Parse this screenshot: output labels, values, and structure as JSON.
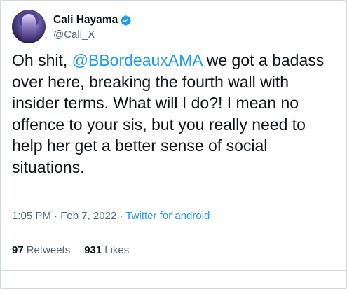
{
  "author": {
    "display_name": "Cali Hayama",
    "handle": "@Cali_X",
    "verified": true,
    "avatar_icon": "avatar-image"
  },
  "tweet": {
    "text_before": "Oh shit, ",
    "mention": "@BBordeauxAMA",
    "text_after": " we got a badass over here, breaking the fourth wall with insider terms. What will I do?! I mean no offence to your sis, but you really need to help her get a better sense of social situations."
  },
  "meta": {
    "time": "1:05 PM",
    "date": "Feb 7, 2022",
    "separator": " · ",
    "source": "Twitter for android"
  },
  "stats": {
    "retweets_count": "97",
    "retweets_label": "Retweets",
    "likes_count": "931",
    "likes_label": "Likes"
  },
  "colors": {
    "accent": "#1d9bf0",
    "text": "#0f1419",
    "secondary": "#536471",
    "border": "#cfd9de"
  }
}
